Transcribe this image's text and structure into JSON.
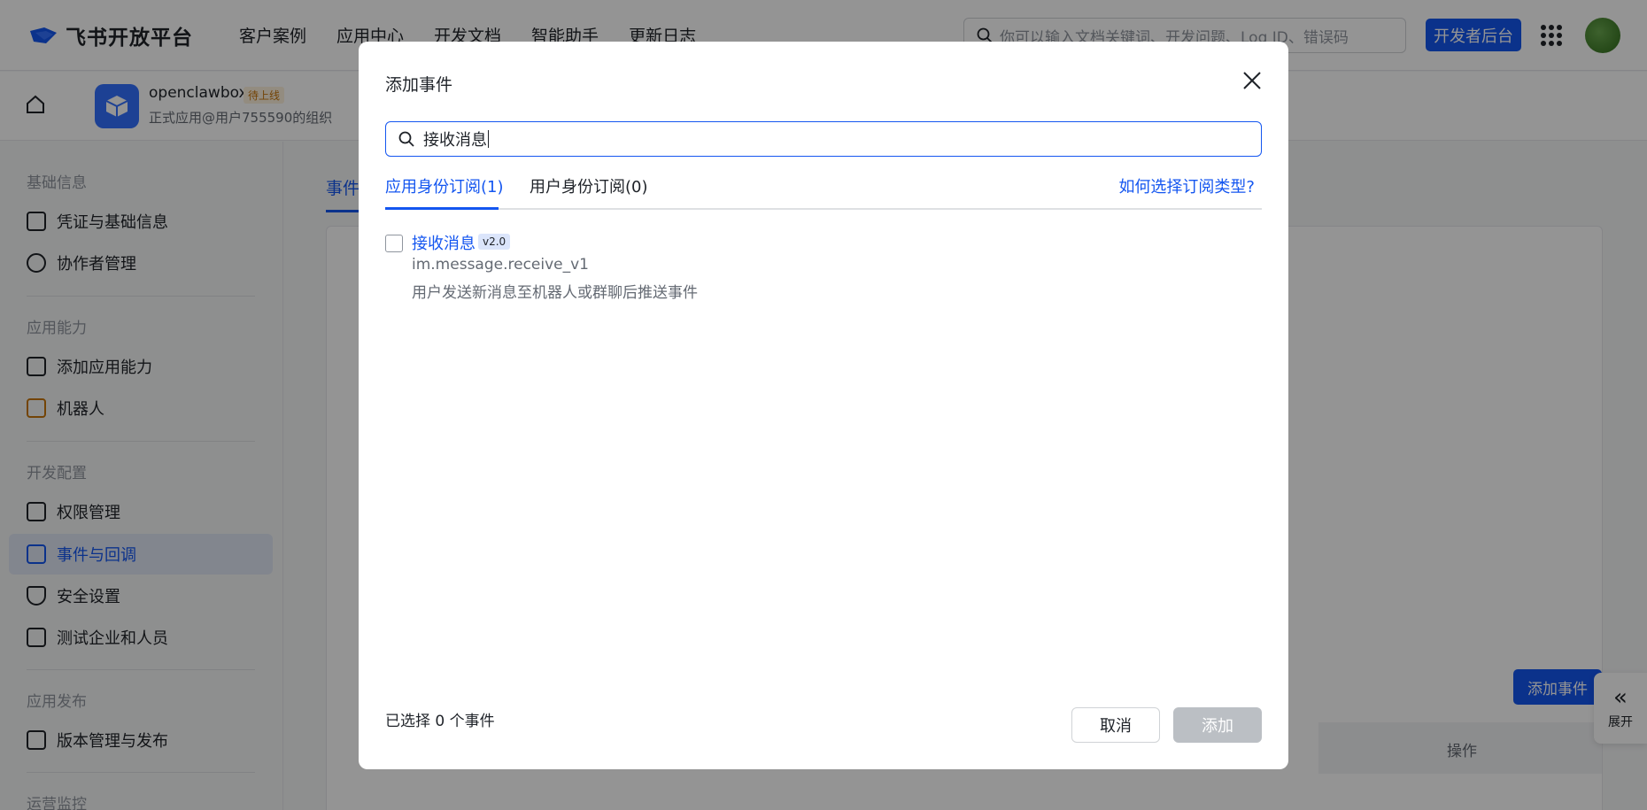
{
  "topnav": {
    "brand": "飞书开放平台",
    "links": [
      "客户案例",
      "应用中心",
      "开发文档",
      "智能助手",
      "更新日志"
    ],
    "search_placeholder": "你可以输入文档关键词、开发问题、Log ID、错误码",
    "dev_button": "开发者后台"
  },
  "app": {
    "name": "openclawbox",
    "badge": "待上线",
    "org": "正式应用@用户755590的组织"
  },
  "sidebar": {
    "groups": [
      {
        "title": "基础信息",
        "items": [
          "凭证与基础信息",
          "协作者管理"
        ]
      },
      {
        "title": "应用能力",
        "items": [
          "添加应用能力",
          "机器人"
        ]
      },
      {
        "title": "开发配置",
        "items": [
          "权限管理",
          "事件与回调",
          "安全设置",
          "测试企业和人员"
        ]
      },
      {
        "title": "应用发布",
        "items": [
          "版本管理与发布"
        ]
      },
      {
        "title": "运营监控",
        "items": []
      }
    ]
  },
  "main": {
    "tab": "事件",
    "add_event_button": "添加事件",
    "op_column": "操作",
    "expand_label": "展开"
  },
  "modal": {
    "title": "添加事件",
    "search_value": "接收消息",
    "tabs": [
      "应用身份订阅(1)",
      "用户身份订阅(0)"
    ],
    "help_link": "如何选择订阅类型?",
    "events": [
      {
        "name": "接收消息",
        "version": "v2.0",
        "key": "im.message.receive_v1",
        "desc": "用户发送新消息至机器人或群聊后推送事件"
      }
    ],
    "selected_count": "已选择 0 个事件",
    "cancel": "取消",
    "add": "添加"
  },
  "colors": {
    "accent": "#1456f0",
    "overlay": "rgba(0,0,0,0.42)"
  }
}
